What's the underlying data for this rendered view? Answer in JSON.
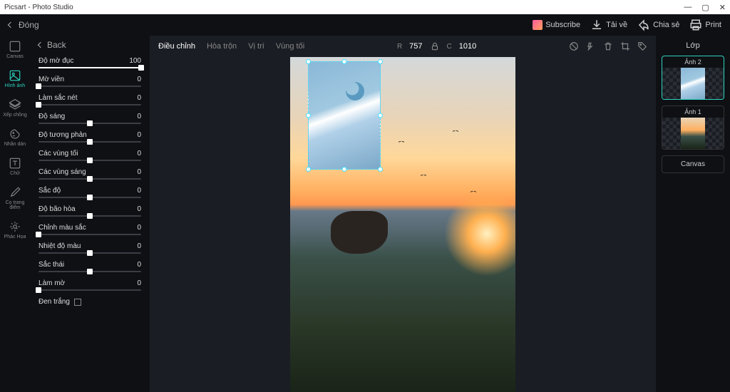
{
  "window": {
    "title": "Picsart - Photo Studio"
  },
  "topbar": {
    "close": "Đóng",
    "subscribe": "Subscribe",
    "download": "Tải về",
    "share": "Chia sẻ",
    "print": "Print"
  },
  "tools": {
    "canvas": "Canvas",
    "image": "Hình ảnh",
    "layers": "Xếp chồng",
    "sticker": "Nhãn dán",
    "text": "Chữ",
    "brush": "Cọ trang điểm",
    "sketch": "Phác Họa"
  },
  "panel": {
    "back": "Back",
    "opacity": {
      "label": "Độ mờ đục",
      "value": "100"
    },
    "feather": {
      "label": "Mờ viền",
      "value": "0"
    },
    "sharpen": {
      "label": "Làm sắc nét",
      "value": "0"
    },
    "brightness": {
      "label": "Độ sáng",
      "value": "0"
    },
    "contrast": {
      "label": "Độ tương phản",
      "value": "0"
    },
    "shadows": {
      "label": "Các vùng tối",
      "value": "0"
    },
    "highlights": {
      "label": "Các vùng sáng",
      "value": "0"
    },
    "saturation": {
      "label": "Sắc độ",
      "value": "0"
    },
    "desaturation": {
      "label": "Độ bão hòa",
      "value": "0"
    },
    "coloradjust": {
      "label": "Chỉnh màu sắc",
      "value": "0"
    },
    "temperature": {
      "label": "Nhiệt độ màu",
      "value": "0"
    },
    "hue": {
      "label": "Sắc thái",
      "value": "0"
    },
    "blur": {
      "label": "Làm mờ",
      "value": "0"
    },
    "bw": "Đen trắng"
  },
  "canvasTabs": {
    "adjust": "Điều chỉnh",
    "blend": "Hòa trộn",
    "position": "Vị trí",
    "shadow": "Vùng tối",
    "r_label": "R",
    "r_val": "757",
    "c_label": "C",
    "c_val": "1010"
  },
  "layers": {
    "title": "Lớp",
    "layer2": "Ảnh 2",
    "layer1": "Ảnh 1",
    "canvas": "Canvas"
  }
}
